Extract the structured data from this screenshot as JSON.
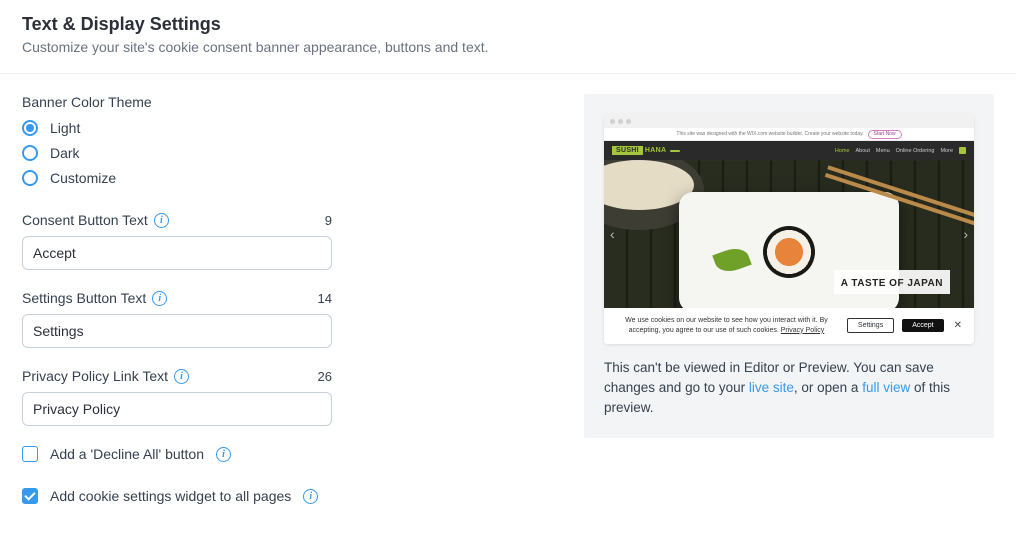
{
  "header": {
    "title": "Text & Display Settings",
    "subtitle": "Customize your site's cookie consent banner appearance, buttons and text."
  },
  "theme": {
    "label": "Banner Color Theme",
    "options": [
      "Light",
      "Dark",
      "Customize"
    ],
    "selected": "Light"
  },
  "fields": {
    "consent": {
      "label": "Consent Button Text",
      "value": "Accept",
      "count": "9"
    },
    "settings": {
      "label": "Settings Button Text",
      "value": "Settings",
      "count": "14"
    },
    "privacy": {
      "label": "Privacy Policy Link Text",
      "value": "Privacy Policy",
      "count": "26"
    }
  },
  "checks": {
    "decline": {
      "label": "Add a 'Decline All' button",
      "checked": false
    },
    "widget": {
      "label": "Add cookie settings widget to all pages",
      "checked": true
    }
  },
  "preview": {
    "wixbar_text": "This site was designed with the WIX.com website builder. Create your website today.",
    "wixbar_btn": "Start Now",
    "logo_a": "SUSHI",
    "logo_b": "HANA",
    "nav": [
      "Home",
      "About",
      "Menu",
      "Online Ordering",
      "More"
    ],
    "hero_title": "A TASTE OF JAPAN",
    "cookie_text_a": "We use cookies on our website to see how you interact with it. By accepting, you agree to our use of such cookies. ",
    "cookie_link": "Privacy Policy",
    "btn_settings": "Settings",
    "btn_accept": "Accept",
    "caption_a": "This can't be viewed in Editor or Preview. You can save changes and go to your ",
    "caption_link1": "live site",
    "caption_b": ", or open a ",
    "caption_link2": "full view",
    "caption_c": " of this preview."
  }
}
